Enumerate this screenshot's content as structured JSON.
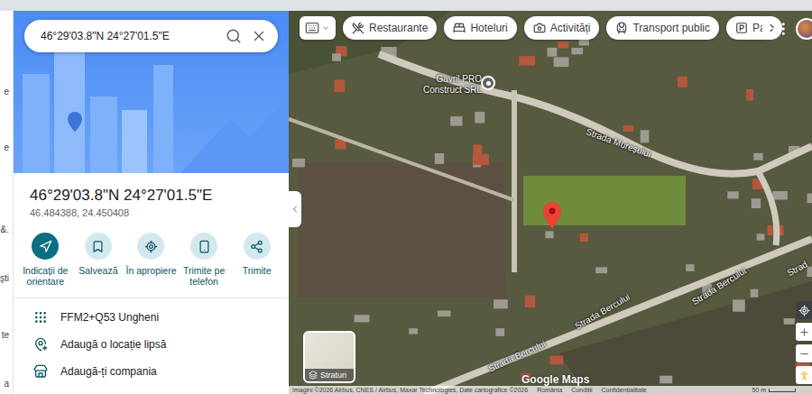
{
  "left_edge": [
    "e",
    "e",
    "&.",
    "şti",
    "te",
    "a"
  ],
  "search": {
    "value": "46°29'03.8\"N 24°27'01.5\"E"
  },
  "place": {
    "title": "46°29'03.8\"N 24°27'01.5\"E",
    "subtitle": "46.484388, 24.450408"
  },
  "actions": [
    {
      "label": "Indicații de orientare",
      "primary": true
    },
    {
      "label": "Salvează",
      "primary": false
    },
    {
      "label": "În apropiere",
      "primary": false
    },
    {
      "label": "Trimite pe telefon",
      "primary": false
    },
    {
      "label": "Trimite",
      "primary": false
    }
  ],
  "info_rows": [
    "FFM2+Q53 Ungheni",
    "Adaugă o locație lipsă",
    "Adaugă-ți compania"
  ],
  "map": {
    "chips": [
      "Restaurante",
      "Hoteluri",
      "Activități",
      "Transport public",
      "Pa"
    ],
    "business_pin": "Gavril PRO Construct SRL",
    "streets": [
      "Strada Mureșului",
      "Strada Bercului",
      "Strada Bercului",
      "Strada Bercului",
      "Strad"
    ],
    "layers_label": "Straturi",
    "logo": "Google Maps",
    "attribution": "Imagini ©2026 Airbus, CNES / Airbus, Maxar Technologies, Date cartografice ©2026",
    "footer_links": [
      "România",
      "Condiții",
      "Confidențialitate"
    ],
    "scale": "50 m"
  }
}
